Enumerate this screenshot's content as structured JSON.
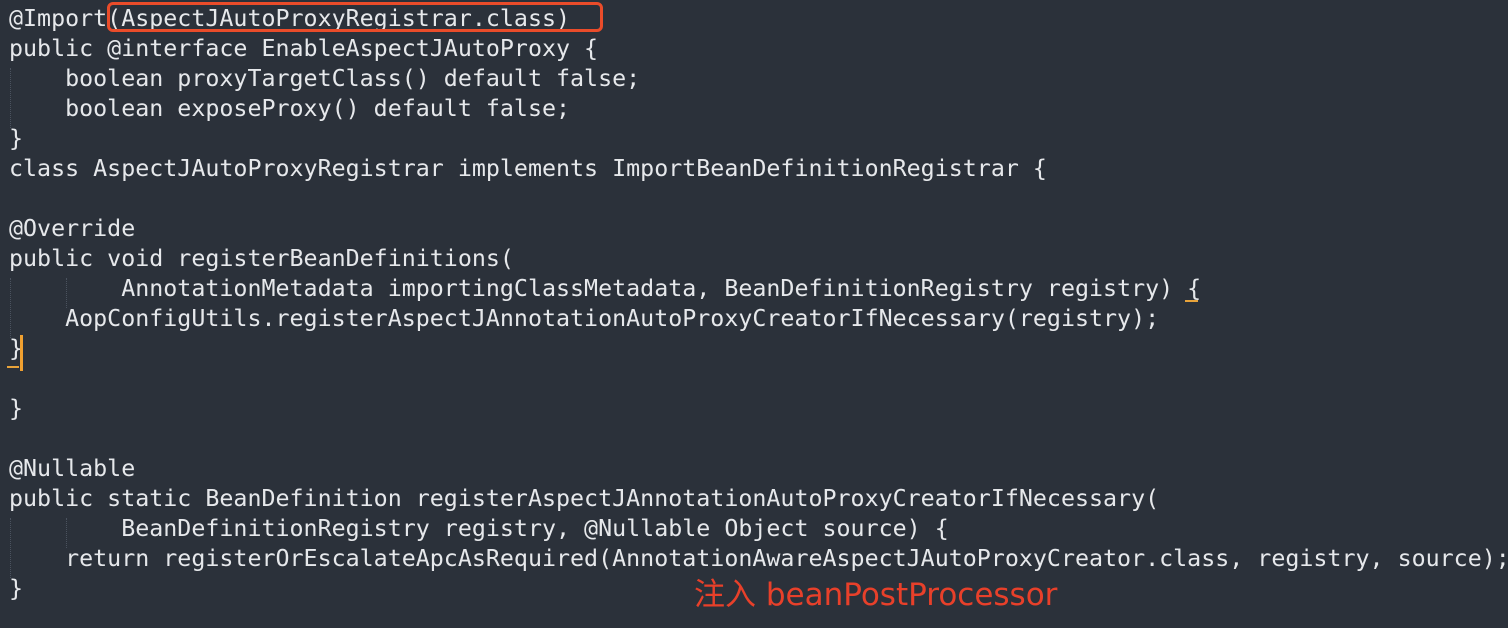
{
  "code_lines": [
    "@Import(AspectJAutoProxyRegistrar.class)",
    "public @interface EnableAspectJAutoProxy {",
    "    boolean proxyTargetClass() default false;",
    "    boolean exposeProxy() default false;",
    "}",
    "class AspectJAutoProxyRegistrar implements ImportBeanDefinitionRegistrar {",
    "",
    "@Override",
    "public void registerBeanDefinitions(",
    "        AnnotationMetadata importingClassMetadata, BeanDefinitionRegistry registry) {",
    "    AopConfigUtils.registerAspectJAnnotationAutoProxyCreatorIfNecessary(registry);",
    "}",
    "",
    "}",
    "",
    "@Nullable",
    "public static BeanDefinition registerAspectJAnnotationAutoProxyCreatorIfNecessary(",
    "        BeanDefinitionRegistry registry, @Nullable Object source) {",
    "    return registerOrEscalateApcAsRequired(AnnotationAwareAspectJAutoProxyCreator.class, registry, source);",
    "}"
  ],
  "annotation_text": "注入 beanPostProcessor",
  "colors": {
    "background": "#2b313a",
    "code_text": "#e6e8eb",
    "highlight_box": "#ea4c2a",
    "annotation": "#e8402a",
    "brace_match": "#e8a33a"
  }
}
